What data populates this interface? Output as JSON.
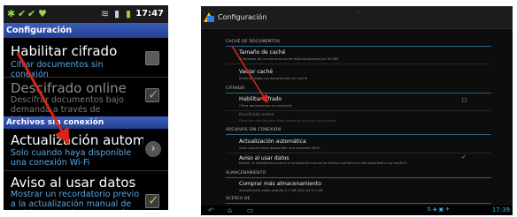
{
  "phone": {
    "status": {
      "time": "17:47",
      "left_icons": [
        "notification-icon",
        "notification-icon",
        "notification-icon",
        "notification-icon"
      ],
      "right_icons": [
        "wifi-icon",
        "signal-icon",
        "battery-icon"
      ]
    },
    "header": "Configuración",
    "items": [
      {
        "title": "Habilitar cifrado",
        "subtitle": "Cifrar documentos sin conexión",
        "control": "checkbox",
        "checked": false
      },
      {
        "title": "Descifrado online",
        "subtitle": "Descifrar documentos bajo demanda a través de Internet",
        "control": "checkbox",
        "checked": true,
        "disabled": true
      }
    ],
    "section": "Archivos sin conexión",
    "items2": [
      {
        "title": "Actualización automática",
        "subtitle": "Solo cuando haya disponible una conexión Wi-Fi",
        "control": "chevron"
      },
      {
        "title": "Aviso al usar datos",
        "subtitle": "Mostrar un recordatorio previo a la actualización manual de archivos cuando no se está",
        "control": "checkbox",
        "checked": true
      }
    ]
  },
  "tablet": {
    "title": "Configuración",
    "sections": {
      "cache": "CACHÉ DE DOCUMENTOS",
      "cifrado": "CIFRADO",
      "offline": "ARCHIVOS SIN CONEXIÓN",
      "storage": "ALMACENAMIENTO",
      "about": "ACERCA DE"
    },
    "items": {
      "cache_size": {
        "title": "Tamaño de caché",
        "sub": "El tamaño de la memoria caché está establecido en 50 MB"
      },
      "clear_cache": {
        "title": "Vaciar caché",
        "sub": "Eliminar todos los documentos en caché"
      },
      "enable_crypto": {
        "title": "Habilitar cifrado",
        "sub": "Cifrar documentos sin conexión"
      },
      "decrypt_online": {
        "title": "Descifrado online",
        "sub": "Descifrar documentos bajo demanda a través de Internet"
      },
      "auto_update": {
        "title": "Actualización automática",
        "sub": "Solo cuando haya disponible una conexión Wi-Fi"
      },
      "data_warning": {
        "title": "Aviso al usar datos",
        "sub": "Mostrar un recordatorio previo a la actualización manual de archivos cuando no se está conectado a una red Wi-Fi",
        "checked": true
      },
      "buy_storage": {
        "title": "Comprar más almacenamiento",
        "sub": "Actualmente estás usando 1,1 GB (4%) de 5,0 GB"
      }
    },
    "nav": {
      "clock": "17:39"
    }
  },
  "colors": {
    "holo_blue": "#33b5e5",
    "phone_header": "#23408f",
    "phone_subtitle": "#5aa7e0",
    "check_green": "#8ecf2e",
    "arrow_red": "#d8261c"
  }
}
